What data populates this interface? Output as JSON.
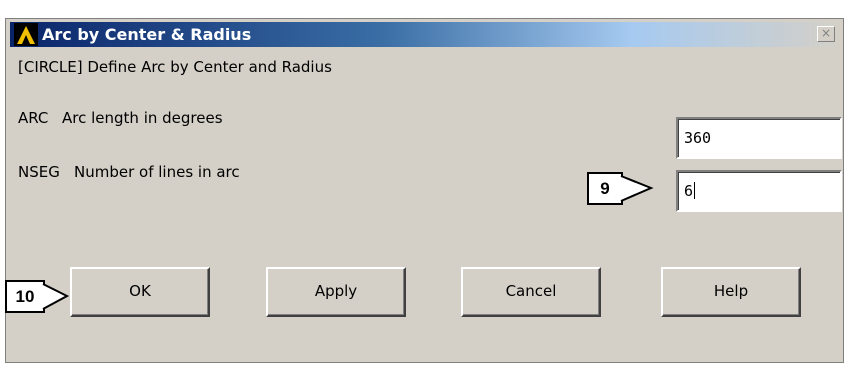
{
  "dialog": {
    "title": "Arc by Center & Radius",
    "close_symbol": "×",
    "heading": "[CIRCLE]  Define Arc by Center and Radius"
  },
  "params": {
    "arc": {
      "code": "ARC",
      "label": "Arc length in degrees",
      "value": "360"
    },
    "nseg": {
      "code": "NSEG",
      "label": "Number of lines in arc",
      "value": "6"
    }
  },
  "buttons": {
    "ok": "OK",
    "apply": "Apply",
    "cancel": "Cancel",
    "help": "Help"
  },
  "callouts": {
    "step_9": "9",
    "step_10": "10"
  },
  "icons": {
    "app": "ansys-logo-icon",
    "close": "close-icon"
  }
}
